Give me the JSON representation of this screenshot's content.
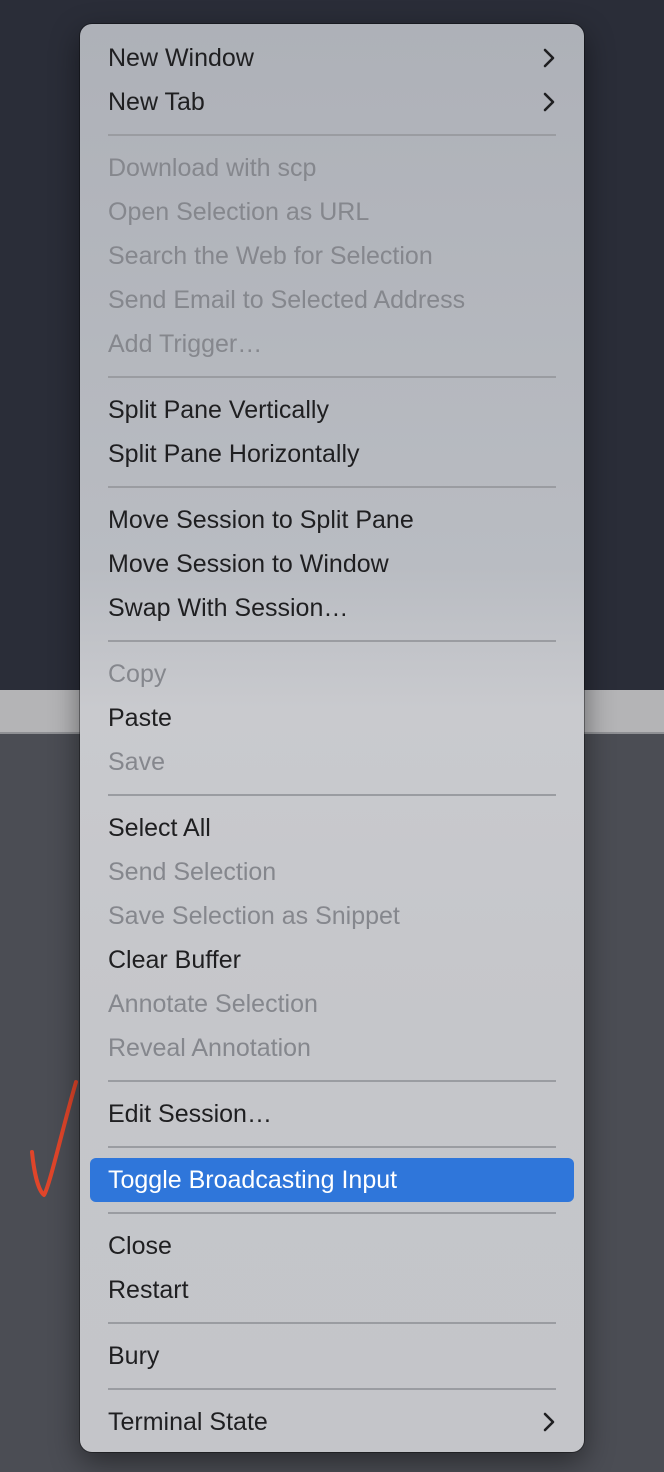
{
  "menu": {
    "items": [
      {
        "label": "New Window",
        "enabled": true,
        "submenu": true
      },
      {
        "label": "New Tab",
        "enabled": true,
        "submenu": true
      },
      {
        "separator": true
      },
      {
        "label": "Download with scp",
        "enabled": false
      },
      {
        "label": "Open Selection as URL",
        "enabled": false
      },
      {
        "label": "Search the Web for Selection",
        "enabled": false
      },
      {
        "label": "Send Email to Selected Address",
        "enabled": false
      },
      {
        "label": "Add Trigger…",
        "enabled": false
      },
      {
        "separator": true
      },
      {
        "label": "Split Pane Vertically",
        "enabled": true
      },
      {
        "label": "Split Pane Horizontally",
        "enabled": true
      },
      {
        "separator": true
      },
      {
        "label": "Move Session to Split Pane",
        "enabled": true
      },
      {
        "label": "Move Session to Window",
        "enabled": true
      },
      {
        "label": "Swap With Session…",
        "enabled": true
      },
      {
        "separator": true
      },
      {
        "label": "Copy",
        "enabled": false
      },
      {
        "label": "Paste",
        "enabled": true
      },
      {
        "label": "Save",
        "enabled": false
      },
      {
        "separator": true
      },
      {
        "label": "Select All",
        "enabled": true
      },
      {
        "label": "Send Selection",
        "enabled": false
      },
      {
        "label": "Save Selection as Snippet",
        "enabled": false
      },
      {
        "label": "Clear Buffer",
        "enabled": true
      },
      {
        "label": "Annotate Selection",
        "enabled": false
      },
      {
        "label": "Reveal Annotation",
        "enabled": false
      },
      {
        "separator": true
      },
      {
        "label": "Edit Session…",
        "enabled": true
      },
      {
        "separator": true
      },
      {
        "label": "Toggle Broadcasting Input",
        "enabled": true,
        "highlighted": true
      },
      {
        "separator": true
      },
      {
        "label": "Close",
        "enabled": true
      },
      {
        "label": "Restart",
        "enabled": true
      },
      {
        "separator": true
      },
      {
        "label": "Bury",
        "enabled": true
      },
      {
        "separator": true
      },
      {
        "label": "Terminal State",
        "enabled": true,
        "submenu": true
      }
    ]
  },
  "colors": {
    "highlight": "#2f76da",
    "enabled_text": "#1f1f21",
    "disabled_text": "#85878d",
    "annotation_mark": "#e0452a"
  },
  "icons": {
    "submenu": "chevron-right-icon",
    "annotation": "hand-drawn-checkmark-icon"
  }
}
